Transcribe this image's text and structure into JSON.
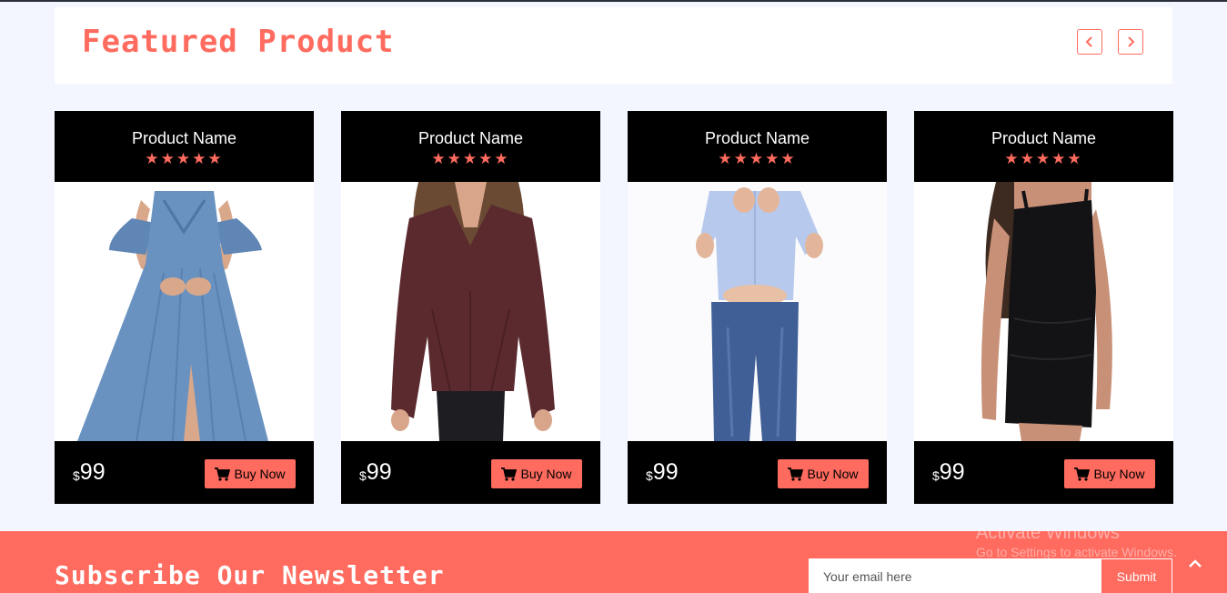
{
  "featured": {
    "title": "Featured Product"
  },
  "products": [
    {
      "name": "Product Name",
      "rating": 5,
      "currency": "$",
      "price": "99",
      "buy_label": "Buy Now",
      "image": "blue-dress"
    },
    {
      "name": "Product Name",
      "rating": 5,
      "currency": "$",
      "price": "99",
      "buy_label": "Buy Now",
      "image": "maroon-blouse"
    },
    {
      "name": "Product Name",
      "rating": 5,
      "currency": "$",
      "price": "99",
      "buy_label": "Buy Now",
      "image": "boy-jeans"
    },
    {
      "name": "Product Name",
      "rating": 5,
      "currency": "$",
      "price": "99",
      "buy_label": "Buy Now",
      "image": "black-dress"
    }
  ],
  "newsletter": {
    "title": "Subscribe Our Newsletter",
    "email_placeholder": "Your email here",
    "submit_label": "Submit"
  },
  "watermark": {
    "line1": "Activate Windows",
    "line2": "Go to Settings to activate Windows."
  },
  "icons": {
    "prev": "chevron-left-icon",
    "next": "chevron-right-icon",
    "cart": "cart-icon",
    "star": "star-icon",
    "scroll_top": "chevron-up-icon"
  },
  "colors": {
    "accent": "#ff6b5f",
    "card_bg": "#000000",
    "page_bg": "#f3f5ff"
  }
}
